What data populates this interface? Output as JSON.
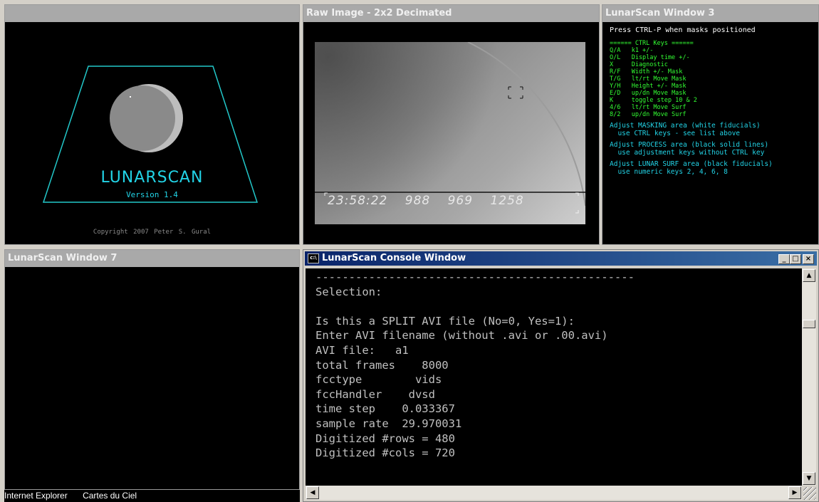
{
  "window1": {
    "title": "",
    "app_name": "LUNARSCAN",
    "version": "Version  1.4",
    "copyright": "Copyright 2007    Peter S. Gural"
  },
  "window2": {
    "title": "Raw Image  -  2x2 Decimated",
    "timestamp": "23:58:22  988  969  1258"
  },
  "window3": {
    "title": "LunarScan Window 3",
    "header": "Press CTRL-P when masks positioned",
    "ctrl_keys": [
      "====== CTRL Keys ======",
      "Q/A   k1 +/-",
      "O/L   Display time +/-",
      "X     Diagnostic",
      "R/F   Width +/- Mask",
      "T/G   lt/rt Move Mask",
      "Y/H   Height +/- Mask",
      "E/D   up/dn Move Mask",
      "K     toggle step 10 & 2",
      "4/6   lt/rt Move Surf",
      "8/2   up/dn Move Surf"
    ],
    "instructions": [
      "Adjust MASKING area (white fiducials)\n  use CTRL keys - see list above",
      "Adjust PROCESS area (black solid lines)\n  use adjustment keys without CTRL key",
      "Adjust LUNAR SURF area (black fiducials)\n  use numeric keys 2, 4, 6, 8"
    ]
  },
  "window7": {
    "title": "LunarScan Window 7"
  },
  "console": {
    "title": "LunarScan Console Window",
    "icon": "console-icon",
    "lines": [
      "------------------------------------------------",
      "Selection:",
      "",
      "Is this a SPLIT AVI file (No=0, Yes=1):",
      "Enter AVI filename (without .avi or .00.avi)",
      "AVI file:   a1",
      "total frames    8000",
      "fcctype        vids",
      "fccHandler    dvsd",
      "time step    0.033367",
      "sample rate  29.970031",
      "Digitized #rows = 480",
      "Digitized #cols = 720"
    ],
    "minimize": "_",
    "maximize": "□",
    "close": "×"
  },
  "taskbar": {
    "items": [
      "Internet Explorer",
      "Cartes du Ciel"
    ]
  },
  "colors": {
    "cyan": "#22d3e6",
    "green": "#33ff33",
    "title_inactive": "#a9a9a9",
    "title_active": "#0a246a"
  }
}
